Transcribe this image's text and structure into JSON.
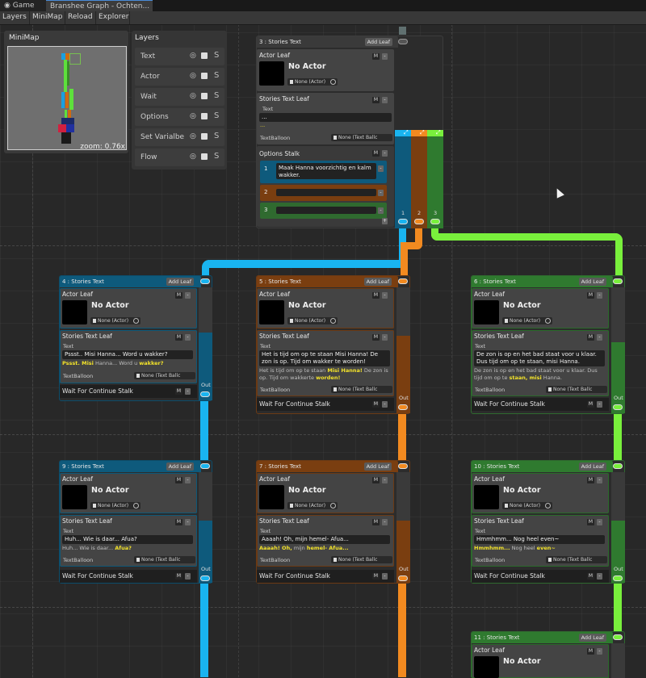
{
  "tabs": {
    "game": "Game",
    "graph": "Branshee Graph - Ochten..."
  },
  "toolbar": {
    "layers": "Layers",
    "minimap": "MiniMap",
    "reload": "Reload",
    "explorer": "Explorer"
  },
  "minimap": {
    "title": "MiniMap",
    "zoom": "zoom: 0.76x"
  },
  "layers_panel": {
    "title": "Layers",
    "items": [
      {
        "label": "Text"
      },
      {
        "label": "Actor"
      },
      {
        "label": "Wait"
      },
      {
        "label": "Options"
      },
      {
        "label": "Set Varialbe"
      },
      {
        "label": "Flow"
      }
    ]
  },
  "common": {
    "add_leaf": "Add Leaf",
    "actor_leaf": "Actor Leaf",
    "no_actor": "No Actor",
    "none_actor": "None (Actor)",
    "stories_text_leaf": "Stories Text Leaf",
    "text_label": "Text",
    "textballoon": "TextBalloon",
    "none_text_balloon": "None (Text Ballc",
    "wait_continue": "Wait For Continue Stalk",
    "out": "Out",
    "m": "M",
    "x": "-"
  },
  "node3": {
    "title": "3 : Stories Text",
    "text_value": "...",
    "preview": "...",
    "options_title": "Options Stalk",
    "options": [
      {
        "num": "1",
        "text": "Maak Hanna voorzichtig en kalm wakker."
      },
      {
        "num": "2",
        "text": ""
      },
      {
        "num": "3",
        "text": ""
      }
    ],
    "ports": [
      "1",
      "2",
      "3"
    ],
    "add_option": "+"
  },
  "node4": {
    "title": "4 : Stories Text",
    "text": "Pssst.. Misi Hanna... Word u wakker?",
    "p1": "Pssst. Misi",
    "p2": " Hanna... Word u ",
    "p3": "wakker?"
  },
  "node5": {
    "title": "5 : Stories Text",
    "text": "Het is tijd om op te staan Misi Hanna! De zon is op. Tijd om wakker te worden!",
    "p1": "Het is tijd om op te staan ",
    "p2": "Misi Hanna!",
    "p3": " De zon is op. Tijd om wakkerte ",
    "p4": "worden!"
  },
  "node6": {
    "title": "6 : Stories Text",
    "text": "De zon is op en het bad staat voor u klaar. Dus tijd om op te staan, misi Hanna.",
    "p1": "De zon is op en het bad staat voor u klaar. Dus tijd om op te ",
    "p2": "staan, misi",
    "p3": " Hanna."
  },
  "node9": {
    "title": "9 : Stories Text",
    "text": "Huh... Wie is daar... Afua?",
    "p1": "Huh... Wie is daar... ",
    "p2": "Afua?"
  },
  "node7": {
    "title": "7 : Stories Text",
    "text": "Aaaah! Oh, mijn hemel- Afua...",
    "p1": "Aaaah! Oh,",
    "p2": " mijn ",
    "p3": "hemel- Afua..."
  },
  "node10": {
    "title": "10 : Stories Text",
    "text": "Hmmhmm... Nog heel even~",
    "p1": "Hmmhmm...",
    "p2": " Nog heel ",
    "p3": "even~"
  },
  "node11": {
    "title": "11 : Stories Text"
  },
  "colors": {
    "blue": "#19b4f0",
    "orange": "#f28a20",
    "green": "#79f03c"
  }
}
